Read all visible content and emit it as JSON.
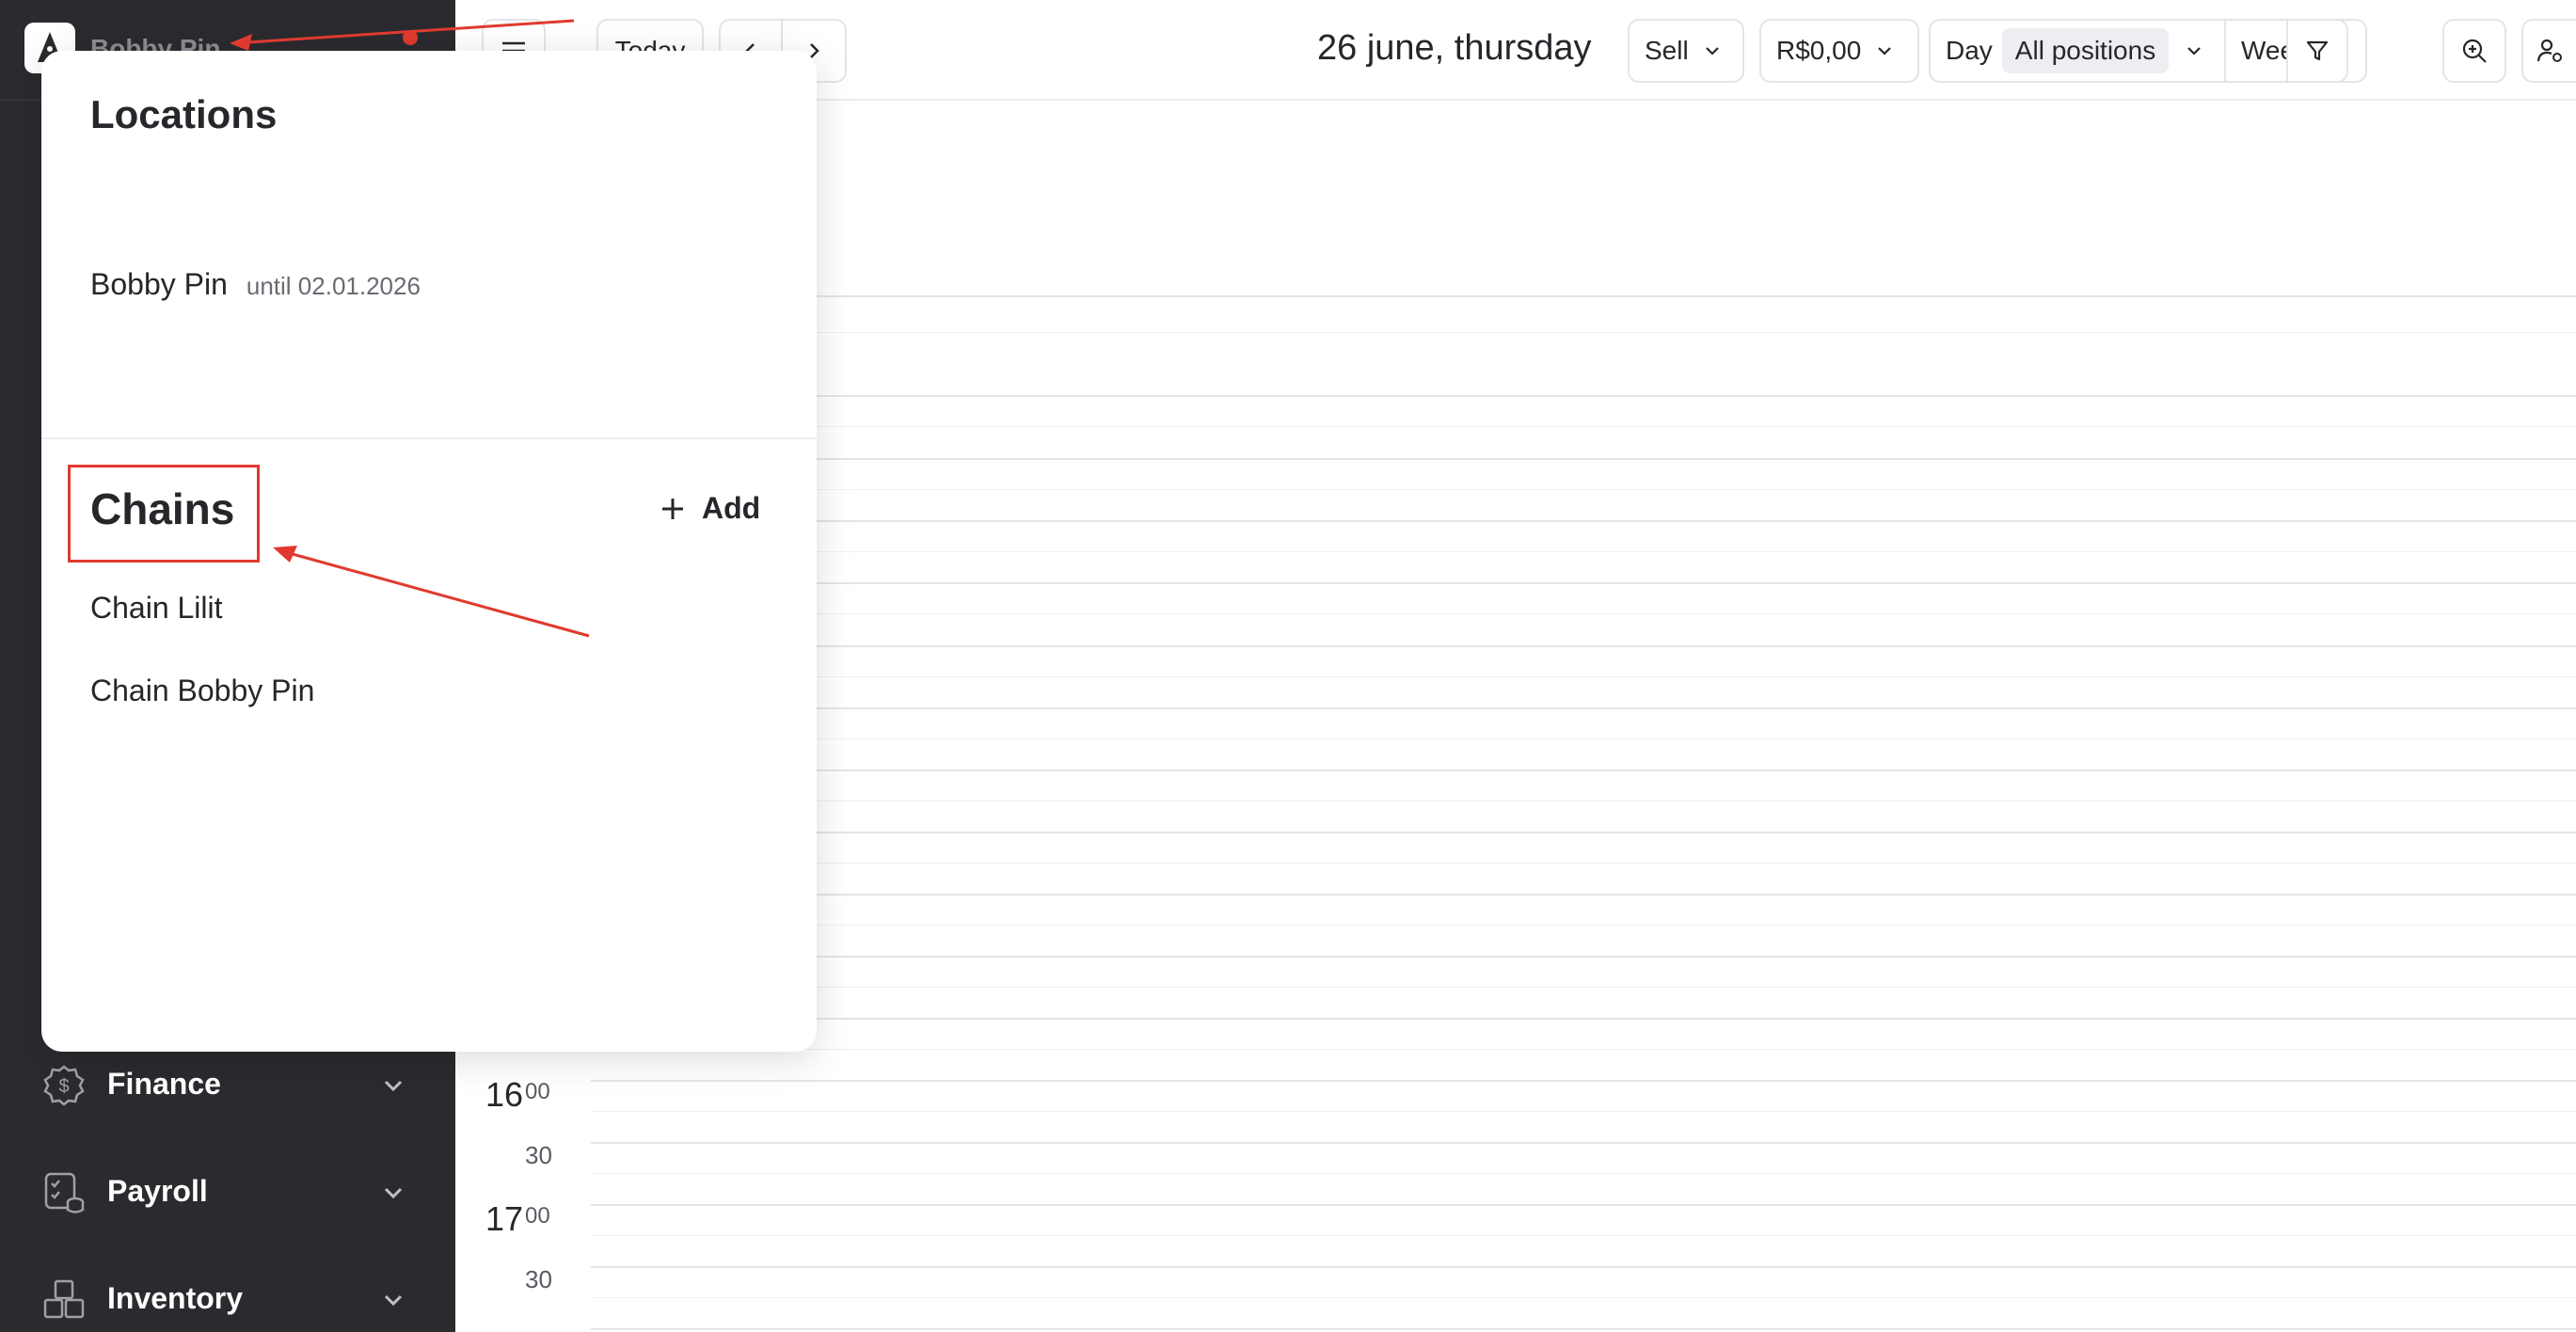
{
  "sidebar": {
    "company_name": "Bobby Pin",
    "items": [
      {
        "label": "Finance",
        "icon": "finance-icon"
      },
      {
        "label": "Payroll",
        "icon": "payroll-icon"
      },
      {
        "label": "Inventory",
        "icon": "inventory-icon"
      }
    ]
  },
  "toolbar": {
    "today_label": "Today",
    "date_title": "26 june, thursday",
    "sell_label": "Sell",
    "amount_label": "R$0,00",
    "day_label": "Day",
    "positions_label": "All positions",
    "week_label": "Week"
  },
  "calendar": {
    "hours": [
      {
        "hour": "16",
        "min": "00"
      },
      {
        "hour": "17",
        "min": "00"
      }
    ],
    "half_labels": [
      "30",
      "30"
    ]
  },
  "popup": {
    "locations_title": "Locations",
    "location": {
      "name": "Bobby Pin",
      "until": "until 02.01.2026"
    },
    "chains_title": "Chains",
    "add_label": "Add",
    "chains": [
      "Chain Lilit",
      "Chain Bobby Pin"
    ]
  },
  "colors": {
    "sidebar_bg": "#2b2b2f",
    "annotation_red": "#e03a2f",
    "chip_bg": "#eceef2"
  }
}
